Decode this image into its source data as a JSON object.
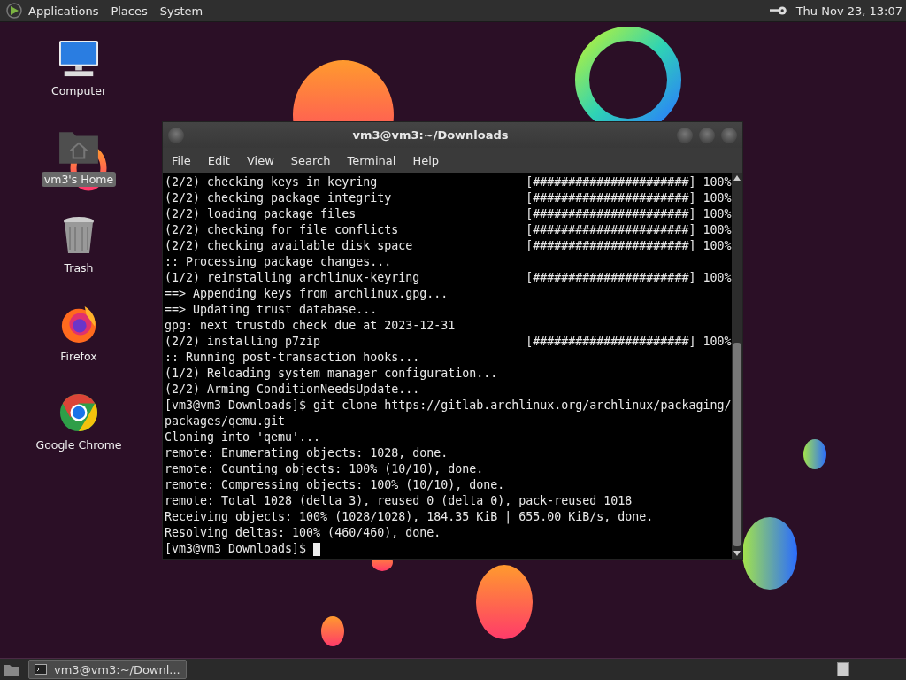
{
  "top_panel": {
    "menus": [
      "Applications",
      "Places",
      "System"
    ],
    "clock": "Thu Nov 23, 13:07"
  },
  "desktop_icons": [
    {
      "kind": "computer",
      "label": "Computer",
      "selected": false
    },
    {
      "kind": "home",
      "label": "vm3's Home",
      "selected": true
    },
    {
      "kind": "trash",
      "label": "Trash",
      "selected": false
    },
    {
      "kind": "firefox",
      "label": "Firefox",
      "selected": false
    },
    {
      "kind": "chrome",
      "label": "Google Chrome",
      "selected": false
    }
  ],
  "terminal": {
    "title": "vm3@vm3:~/Downloads",
    "menu": [
      "File",
      "Edit",
      "View",
      "Search",
      "Terminal",
      "Help"
    ],
    "lines": [
      {
        "kind": "progress",
        "text": "(2/2) checking keys in keyring",
        "bar": "[######################]",
        "percent": "100%"
      },
      {
        "kind": "progress",
        "text": "(2/2) checking package integrity",
        "bar": "[######################]",
        "percent": "100%"
      },
      {
        "kind": "progress",
        "text": "(2/2) loading package files",
        "bar": "[######################]",
        "percent": "100%"
      },
      {
        "kind": "progress",
        "text": "(2/2) checking for file conflicts",
        "bar": "[######################]",
        "percent": "100%"
      },
      {
        "kind": "progress",
        "text": "(2/2) checking available disk space",
        "bar": "[######################]",
        "percent": "100%"
      },
      {
        "kind": "plain",
        "text": ":: Processing package changes..."
      },
      {
        "kind": "progress",
        "text": "(1/2) reinstalling archlinux-keyring",
        "bar": "[######################]",
        "percent": "100%"
      },
      {
        "kind": "plain",
        "text": "==> Appending keys from archlinux.gpg..."
      },
      {
        "kind": "plain",
        "text": "==> Updating trust database..."
      },
      {
        "kind": "plain",
        "text": "gpg: next trustdb check due at 2023-12-31"
      },
      {
        "kind": "progress",
        "text": "(2/2) installing p7zip",
        "bar": "[######################]",
        "percent": "100%"
      },
      {
        "kind": "plain",
        "text": ":: Running post-transaction hooks..."
      },
      {
        "kind": "plain",
        "text": "(1/2) Reloading system manager configuration..."
      },
      {
        "kind": "plain",
        "text": "(2/2) Arming ConditionNeedsUpdate..."
      },
      {
        "kind": "plain",
        "text": "[vm3@vm3 Downloads]$ git clone https://gitlab.archlinux.org/archlinux/packaging/"
      },
      {
        "kind": "plain",
        "text": "packages/qemu.git"
      },
      {
        "kind": "plain",
        "text": "Cloning into 'qemu'..."
      },
      {
        "kind": "plain",
        "text": "remote: Enumerating objects: 1028, done."
      },
      {
        "kind": "plain",
        "text": "remote: Counting objects: 100% (10/10), done."
      },
      {
        "kind": "plain",
        "text": "remote: Compressing objects: 100% (10/10), done."
      },
      {
        "kind": "plain",
        "text": "remote: Total 1028 (delta 3), reused 0 (delta 0), pack-reused 1018"
      },
      {
        "kind": "plain",
        "text": "Receiving objects: 100% (1028/1028), 184.35 KiB | 655.00 KiB/s, done."
      },
      {
        "kind": "plain",
        "text": "Resolving deltas: 100% (460/460), done."
      },
      {
        "kind": "prompt",
        "text": "[vm3@vm3 Downloads]$"
      }
    ]
  },
  "taskbar": {
    "tasks": [
      {
        "label": "vm3@vm3:~/Downl...",
        "selected": true
      }
    ]
  }
}
